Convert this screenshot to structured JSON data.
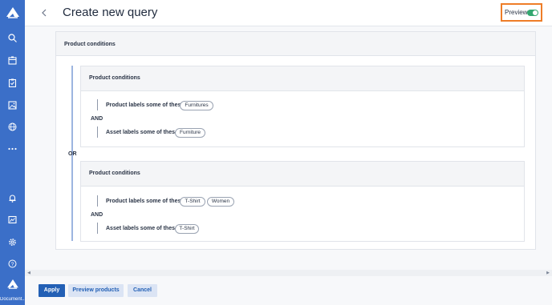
{
  "sidebar": {
    "label": "Document...",
    "icons": [
      "logo-icon",
      "search-icon",
      "product-catalog-icon",
      "task-board-icon",
      "asset-library-icon",
      "globe-icon",
      "more-icon",
      "bell-icon",
      "analytics-icon",
      "settings-icon",
      "help-icon",
      "workspace-logo-icon"
    ]
  },
  "header": {
    "title": "Create new query",
    "preview_label": "Preview",
    "preview_enabled": true
  },
  "query": {
    "root_title": "Product conditions",
    "groups": [
      {
        "title": "Product conditions",
        "conditions": [
          {
            "label": "Product labels some of these",
            "chips": [
              "Furnitures"
            ]
          },
          {
            "label": "Asset labels some of these",
            "chips": [
              "Furniture"
            ]
          }
        ],
        "operator": "AND"
      },
      {
        "title": "Product conditions",
        "conditions": [
          {
            "label": "Product labels some of these",
            "chips": [
              "T-Shirt",
              "Women"
            ]
          },
          {
            "label": "Asset labels some of these",
            "chips": [
              "T-Shirt"
            ]
          }
        ],
        "operator": "AND"
      }
    ],
    "group_operator": "OR"
  },
  "footer": {
    "apply_label": "Apply",
    "preview_products_label": "Preview products",
    "cancel_label": "Cancel"
  },
  "colors": {
    "sidebar": "#3b6fc8",
    "accent": "#2360b5",
    "toggle_on": "#33a76f",
    "highlight": "#ee7d28"
  }
}
